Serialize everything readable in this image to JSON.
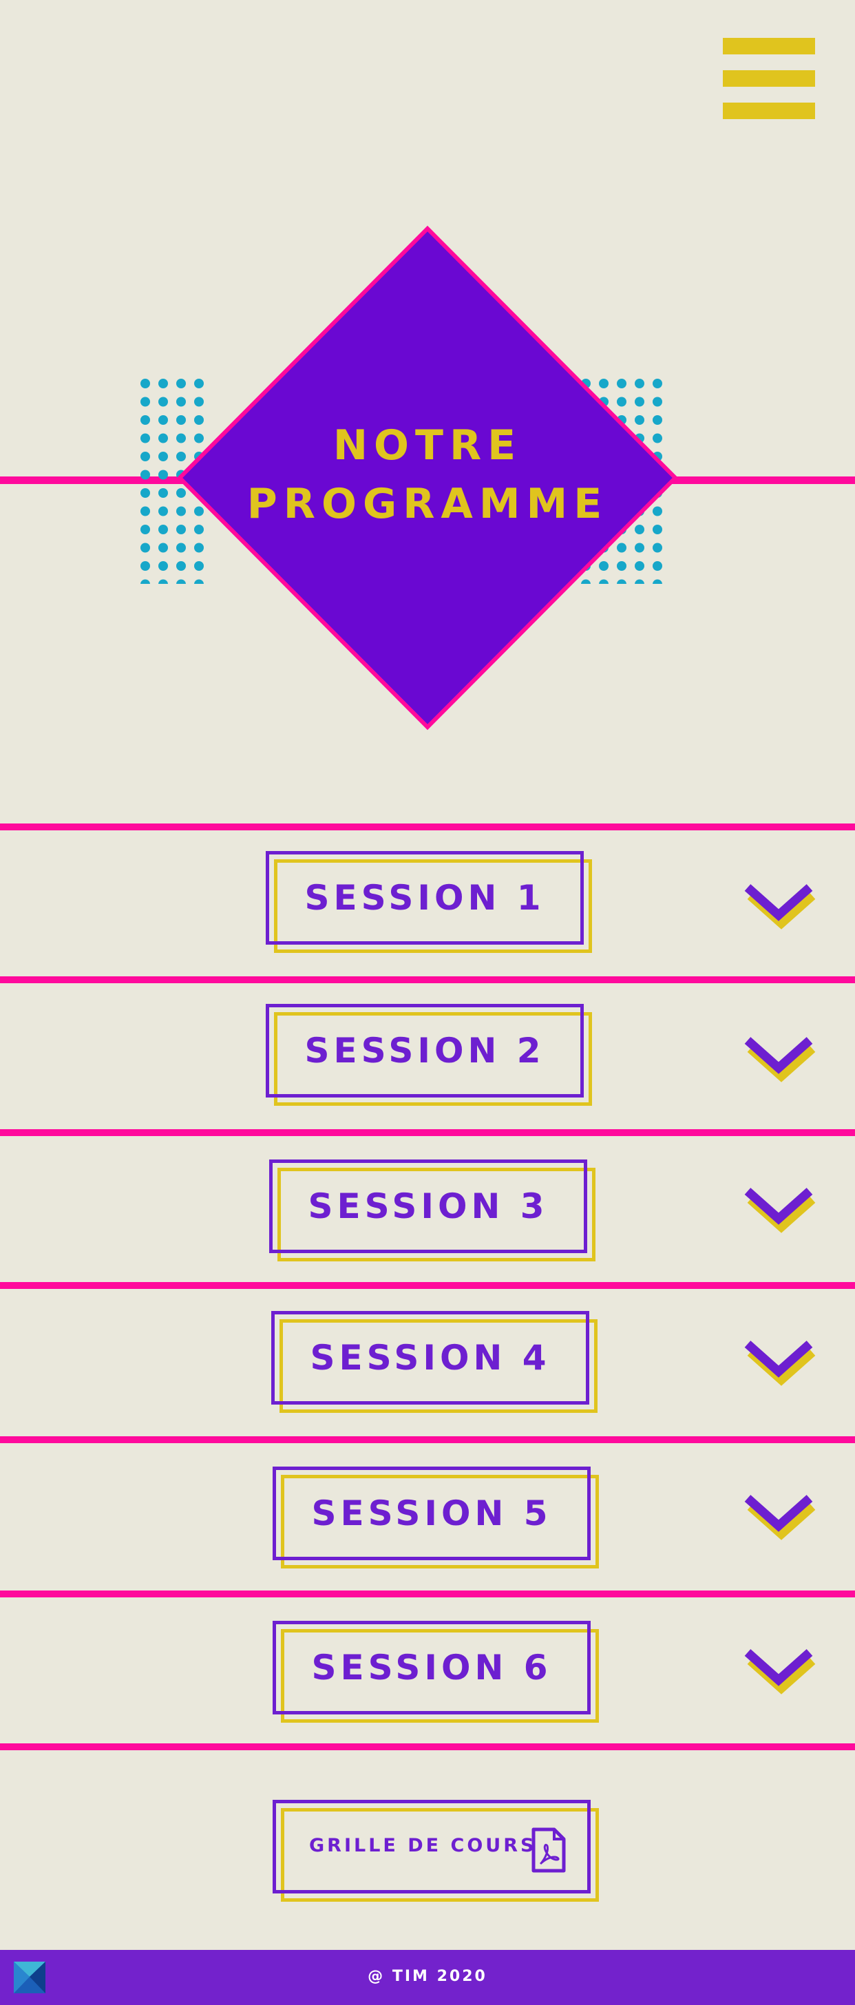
{
  "header": {
    "menu_icon": "hamburger-icon"
  },
  "hero": {
    "title_line1": "NOTRE",
    "title_line2": "PROGRAMME"
  },
  "sessions": [
    {
      "label": "SESSION 1",
      "icon": "chevron-down-icon"
    },
    {
      "label": "SESSION 2",
      "icon": "chevron-down-icon"
    },
    {
      "label": "SESSION 3",
      "icon": "chevron-down-icon"
    },
    {
      "label": "SESSION 4",
      "icon": "chevron-down-icon"
    },
    {
      "label": "SESSION 5",
      "icon": "chevron-down-icon"
    },
    {
      "label": "SESSION 6",
      "icon": "chevron-down-icon"
    }
  ],
  "grille": {
    "label": "GRILLE DE COURS",
    "icon": "pdf-file-icon"
  },
  "footer": {
    "text": "@ TIM 2020",
    "logo": "site-logo"
  },
  "colors": {
    "background": "#eae8dc",
    "purple": "#6d1fd0",
    "yellow": "#e0c41e",
    "pink": "#ff0a9c",
    "cyan": "#17a7c9",
    "footer": "#7322cc"
  }
}
